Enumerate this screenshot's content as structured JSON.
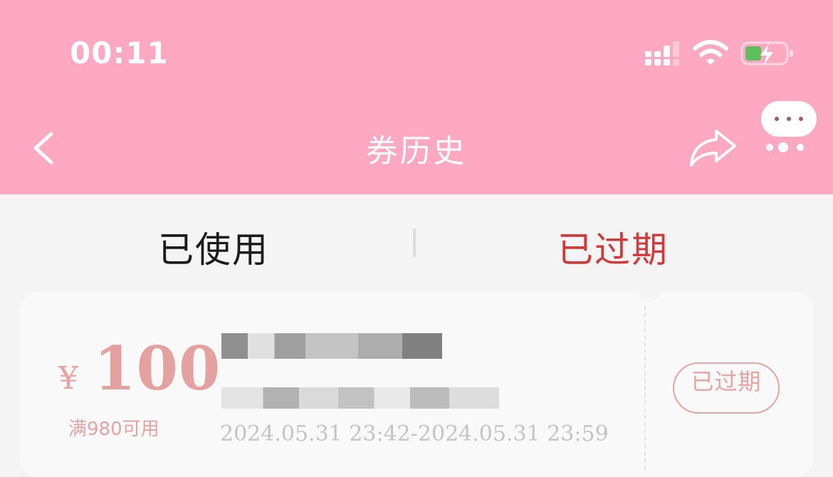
{
  "status_bar": {
    "time": "00:11"
  },
  "nav": {
    "title": "券历史"
  },
  "tabs": [
    {
      "label": "已使用",
      "active": false
    },
    {
      "label": "已过期",
      "active": true
    }
  ],
  "colors": {
    "header_bg": "#ffa8c3",
    "active_tab": "#d03a3a",
    "coupon_accent": "#e5a0a0"
  },
  "icons": [
    "back-icon",
    "share-icon",
    "more-icon",
    "signal-icon",
    "wifi-icon",
    "battery-icon"
  ],
  "coupon": {
    "currency": "¥",
    "amount": "100",
    "condition": "满980可用",
    "validity": "2024.05.31 23:42-2024.05.31 23:59",
    "status": "已过期"
  }
}
